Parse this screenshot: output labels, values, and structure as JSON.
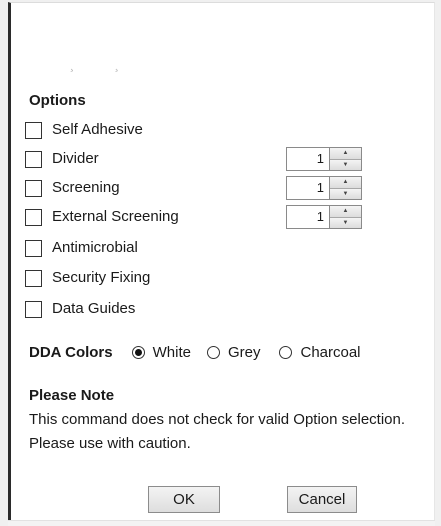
{
  "options": {
    "title": "Options",
    "items": [
      {
        "label": "Self Adhesive"
      },
      {
        "label": "Divider",
        "quantity": "1"
      },
      {
        "label": "Screening",
        "quantity": "1"
      },
      {
        "label": "External Screening",
        "quantity": "1"
      },
      {
        "label": "Antimicrobial"
      },
      {
        "label": "Security Fixing"
      },
      {
        "label": "Data Guides"
      }
    ]
  },
  "dda": {
    "title": "DDA Colors",
    "choices": [
      {
        "label": "White",
        "selected": true
      },
      {
        "label": "Grey",
        "selected": false
      },
      {
        "label": "Charcoal",
        "selected": false
      }
    ]
  },
  "note": {
    "title": "Please Note",
    "text": "This command does not check for valid Option selection. Please use with caution."
  },
  "buttons": {
    "ok_label": "OK",
    "cancel_label": "Cancel"
  }
}
